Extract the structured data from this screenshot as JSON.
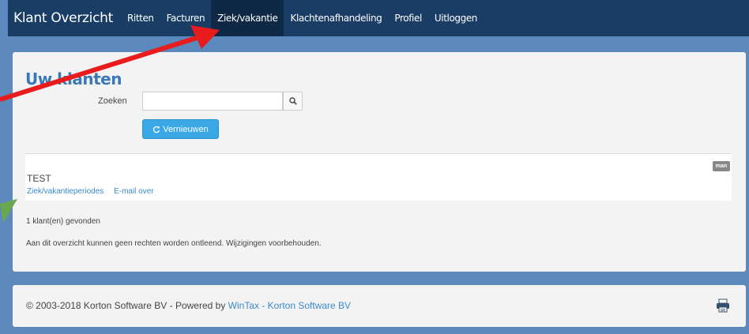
{
  "navbar": {
    "brand": "Klant Overzicht",
    "items": [
      {
        "label": "Ritten",
        "active": false
      },
      {
        "label": "Facturen",
        "active": false
      },
      {
        "label": "Ziek/vakantie",
        "active": true
      },
      {
        "label": "Klachtenafhandeling",
        "active": false
      },
      {
        "label": "Profiel",
        "active": false
      },
      {
        "label": "Uitloggen",
        "active": false
      }
    ]
  },
  "main": {
    "title": "Uw klanten",
    "search": {
      "label": "Zoeken",
      "value": "",
      "placeholder": "",
      "icon": "search-icon"
    },
    "refresh_button": {
      "label": "Vernieuwen",
      "icon": "refresh-icon"
    },
    "client": {
      "name": "TEST",
      "badge": "man",
      "links": [
        "Ziek/vakantieperiodes",
        "E-mail over"
      ]
    },
    "found_count": "1 klant(en) gevonden",
    "disclaimer": "Aan dit overzicht kunnen geen rechten worden ontleend. Wijzigingen voorbehouden."
  },
  "footer": {
    "copyright": "© 2003-2018 Korton Software BV - Powered by ",
    "link": "WinTax - Korton Software BV",
    "print_icon": "print-icon"
  },
  "annotations": {
    "red_arrow_color": "#e81c1c",
    "green_arrow_color": "#6aa84f"
  }
}
